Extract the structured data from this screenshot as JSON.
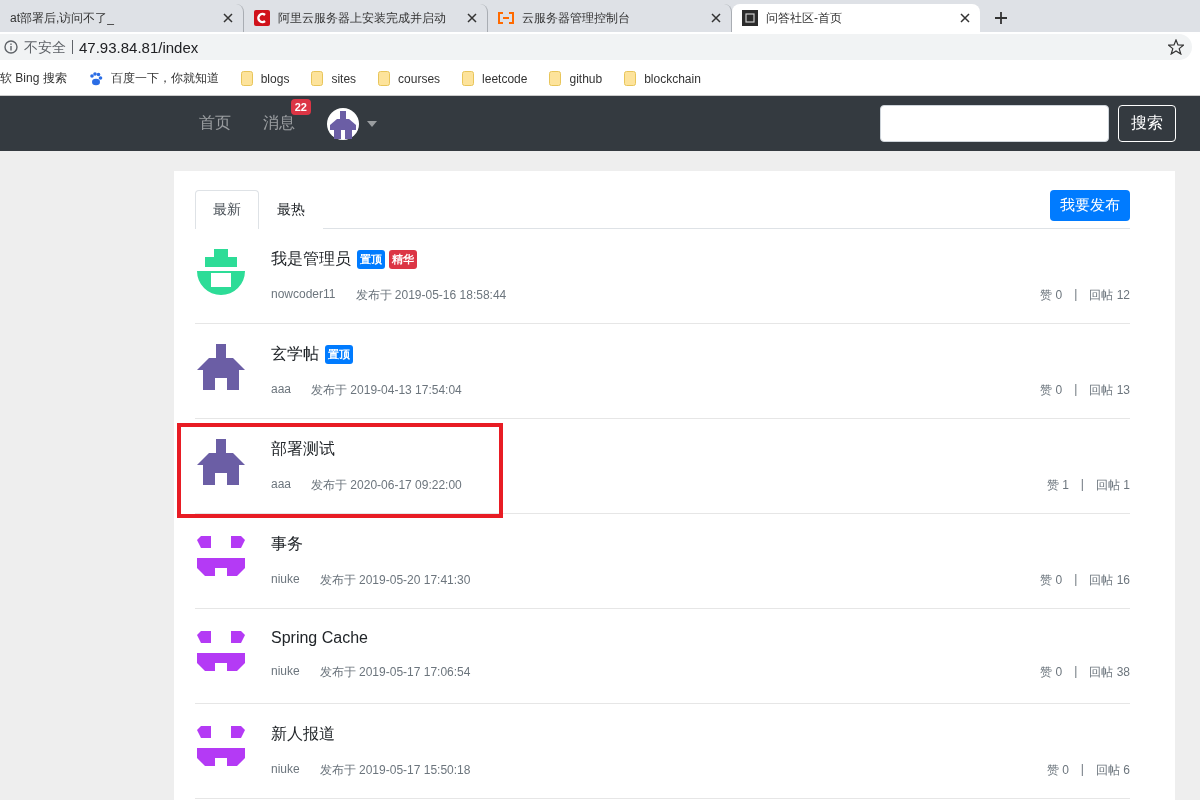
{
  "browser": {
    "tabs": [
      {
        "title": "at部署后,访问不了_",
        "selected": false
      },
      {
        "title": "阿里云服务器上安装完成并启动",
        "kind": "red-c",
        "selected": false
      },
      {
        "title": "云服务器管理控制台",
        "kind": "orange-bracket",
        "selected": false
      },
      {
        "title": "问答社区-首页",
        "kind": "dark-square",
        "selected": true
      }
    ],
    "security": "不安全",
    "url": "47.93.84.81/index",
    "bookmarks": [
      {
        "label": "软 Bing 搜索",
        "kind": "plain"
      },
      {
        "label": "百度一下，你就知道",
        "kind": "paw"
      },
      {
        "label": "blogs",
        "kind": "folder"
      },
      {
        "label": "sites",
        "kind": "folder"
      },
      {
        "label": "courses",
        "kind": "folder"
      },
      {
        "label": "leetcode",
        "kind": "folder"
      },
      {
        "label": "github",
        "kind": "folder"
      },
      {
        "label": "blockchain",
        "kind": "folder"
      }
    ]
  },
  "navbar": {
    "links": [
      {
        "label": "首页"
      },
      {
        "label": "消息",
        "badge": "22"
      }
    ],
    "search_button": "搜索"
  },
  "tabs": [
    {
      "label": "最新",
      "selected": true
    },
    {
      "label": "最热",
      "selected": false
    }
  ],
  "publish_button": "我要发布",
  "posts": [
    {
      "title": "我是管理员",
      "tags": [
        {
          "label": "置顶",
          "color": "#007bff"
        },
        {
          "label": "精华",
          "color": "#dc3545"
        }
      ],
      "author": "nowcoder11",
      "time": "发布于 2019-05-16 18:58:44",
      "likes": "赞 0",
      "sep": "|",
      "replies": "回帖 12",
      "avatar": {
        "kind": "plug",
        "color": "#2ddc97"
      },
      "highlighted": false
    },
    {
      "title": "玄学帖",
      "tags": [
        {
          "label": "置顶",
          "color": "#007bff"
        }
      ],
      "author": "aaa",
      "time": "发布于 2019-04-13 17:54:04",
      "likes": "赞 0",
      "sep": "|",
      "replies": "回帖 13",
      "avatar": {
        "kind": "cross",
        "color": "#6b5ea5"
      },
      "highlighted": false
    },
    {
      "title": "部署测试",
      "author": "aaa",
      "time": "发布于 2020-06-17 09:22:00",
      "likes": "赞 1",
      "sep": "|",
      "replies": "回帖 1",
      "avatar": {
        "kind": "cross",
        "color": "#6b5ea5"
      },
      "highlighted": true
    },
    {
      "title": "事务",
      "author": "niuke",
      "time": "发布于 2019-05-20 17:41:30",
      "likes": "赞 0",
      "sep": "|",
      "replies": "回帖 16",
      "avatar": {
        "kind": "face",
        "color": "#b43af5"
      },
      "highlighted": false
    },
    {
      "title": "Spring Cache",
      "author": "niuke",
      "time": "发布于 2019-05-17 17:06:54",
      "likes": "赞 0",
      "sep": "|",
      "replies": "回帖 38",
      "avatar": {
        "kind": "face",
        "color": "#b43af5"
      },
      "highlighted": false
    },
    {
      "title": "新人报道",
      "author": "niuke",
      "time": "发布于 2019-05-17 15:50:18",
      "likes": "赞 0",
      "sep": "|",
      "replies": "回帖 6",
      "avatar": {
        "kind": "face",
        "color": "#b43af5"
      },
      "highlighted": false
    }
  ]
}
